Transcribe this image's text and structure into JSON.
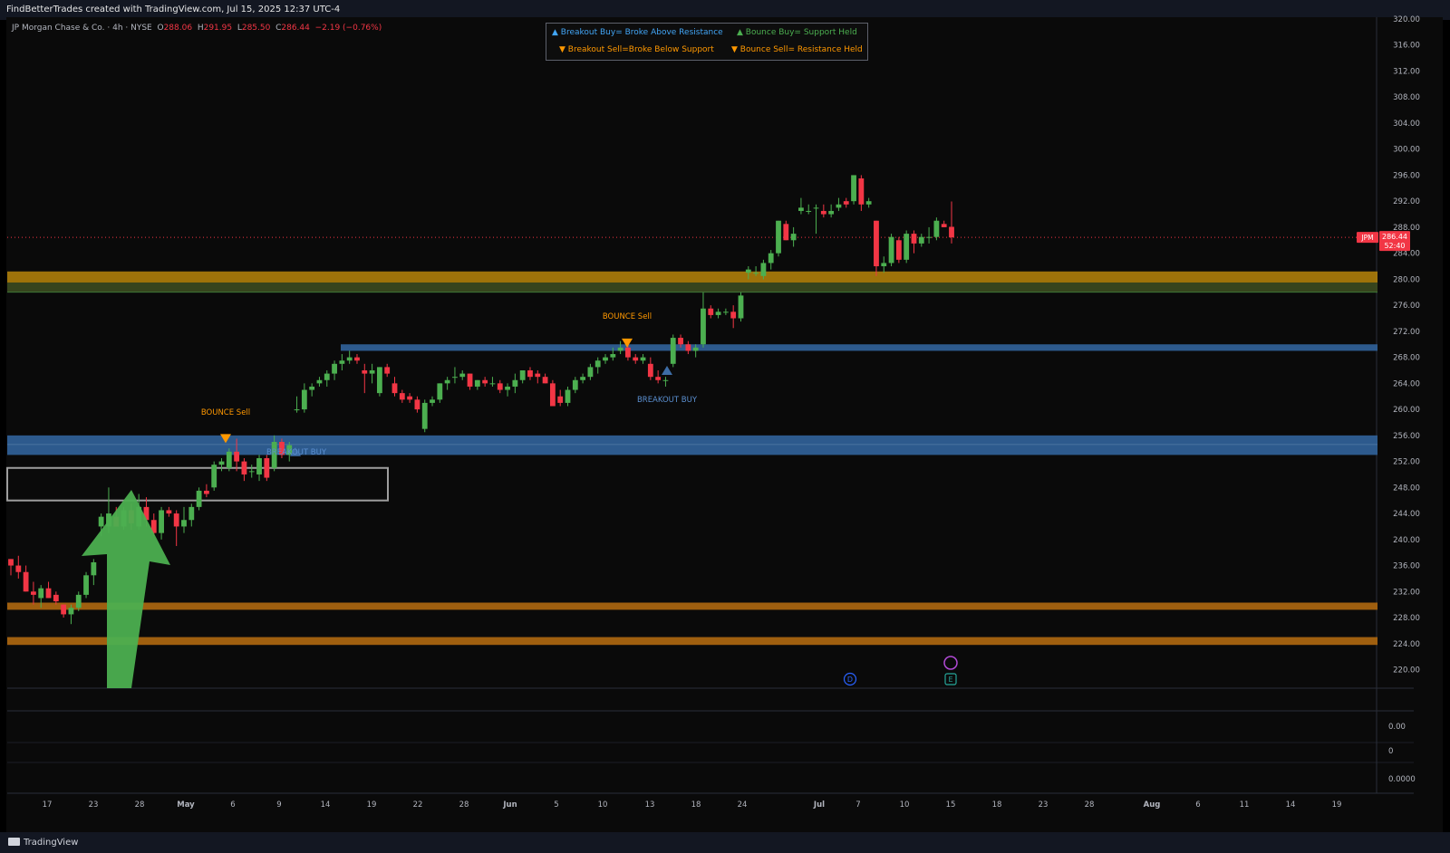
{
  "header": {
    "caption": "FindBetterTrades created with TradingView.com, Jul 15, 2025 12:37 UTC-4",
    "symbol_title": "JP Morgan Chase & Co. · 4h · NYSE",
    "ohlc": {
      "o_label": "O",
      "o_value": "288.06",
      "h_label": "H",
      "h_value": "291.95",
      "l_label": "L",
      "l_value": "285.50",
      "c_label": "C",
      "c_value": "286.44",
      "change": "−2.19 (−0.76%)"
    }
  },
  "legend": {
    "breakout_buy": "▲ Breakout Buy= Broke Above Resistance",
    "bounce_buy": "▲ Bounce Buy= Support Held",
    "breakout_sell": "▼ Breakout Sell=Broke Below Support",
    "bounce_sell": "▼ Bounce Sell= Resistance Held"
  },
  "price_tag": {
    "ticker": "JPM",
    "price": "286.44",
    "countdown": "52:40"
  },
  "footer": {
    "brand": "TradingView"
  },
  "colors": {
    "up": "#4caf50",
    "down": "#f23645",
    "support_blue": "#2f5f95",
    "gold": "#b8860b",
    "orange_band": "#a86410",
    "arrow_green": "#4caf50",
    "signal_orange": "#ff9800",
    "signal_blue": "#3d6da6"
  },
  "chart_data": {
    "type": "candlestick",
    "y_axis": {
      "ticks": [
        "320.00",
        "316.00",
        "312.00",
        "308.00",
        "304.00",
        "300.00",
        "296.00",
        "292.00",
        "288.00",
        "284.00",
        "280.00",
        "276.00",
        "272.00",
        "268.00",
        "264.00",
        "260.00",
        "256.00",
        "252.00",
        "248.00",
        "244.00",
        "240.00",
        "236.00",
        "232.00",
        "228.00",
        "224.00",
        "220.00"
      ],
      "range": [
        217.5,
        320.5
      ],
      "position": "right"
    },
    "x_axis": {
      "labels": [
        "17",
        "23",
        "28",
        "May",
        "6",
        "9",
        "14",
        "19",
        "22",
        "28",
        "Jun",
        "5",
        "10",
        "13",
        "18",
        "24",
        "Jul",
        "7",
        "10",
        "15",
        "18",
        "23",
        "28",
        "Aug",
        "6",
        "11",
        "14",
        "19"
      ]
    },
    "indicator_axis": {
      "ticks": [
        "0.00",
        "0",
        "0.0000"
      ]
    },
    "current_price": 286.44,
    "candles": [
      [
        237,
        237,
        234.5,
        236
      ],
      [
        236,
        237.5,
        234,
        235
      ],
      [
        235,
        236,
        232,
        232
      ],
      [
        232,
        233.5,
        230,
        231.5
      ],
      [
        231,
        233,
        229.5,
        232.5
      ],
      [
        232.5,
        233.5,
        231,
        231
      ],
      [
        231.5,
        232,
        230,
        230.5
      ],
      [
        230,
        230,
        228,
        228.5
      ],
      [
        228.5,
        230,
        227,
        229.5
      ],
      [
        229.5,
        232,
        229,
        231.5
      ],
      [
        231.5,
        235,
        231,
        234.5
      ],
      [
        234.5,
        237,
        233,
        236.5
      ],
      [
        242,
        244,
        240.5,
        243.5
      ],
      [
        242,
        248,
        241,
        244
      ],
      [
        243.5,
        245,
        242,
        242
      ],
      [
        242,
        245,
        241.5,
        244.5
      ],
      [
        244.5,
        245.5,
        241.5,
        242.5
      ],
      [
        242,
        247,
        241.5,
        245
      ],
      [
        245,
        246.5,
        242,
        243
      ],
      [
        243,
        244,
        240.5,
        241
      ],
      [
        241,
        245,
        240,
        244.5
      ],
      [
        244.5,
        245,
        243.5,
        244
      ],
      [
        244,
        244.5,
        239,
        242
      ],
      [
        242,
        245,
        241,
        243
      ],
      [
        243,
        245.5,
        242,
        245
      ],
      [
        245,
        248,
        244.5,
        247.5
      ],
      [
        247.5,
        248.5,
        246.5,
        247
      ],
      [
        248,
        252,
        247.5,
        251.5
      ],
      [
        251.5,
        252.5,
        250.5,
        252
      ],
      [
        251,
        254,
        250.5,
        253.5
      ],
      [
        253.5,
        255.5,
        250.5,
        252
      ],
      [
        252,
        252.5,
        249,
        250
      ],
      [
        250.5,
        251.5,
        249.5,
        250.5
      ],
      [
        250,
        253,
        249,
        252.5
      ],
      [
        252.5,
        253,
        249,
        249.5
      ],
      [
        251,
        256,
        250.5,
        255
      ],
      [
        255,
        255.5,
        252.5,
        253
      ],
      [
        253,
        255,
        252,
        254.5
      ],
      [
        260,
        262,
        259.5,
        260
      ],
      [
        260,
        264,
        259.5,
        263
      ],
      [
        263,
        264,
        262,
        263.5
      ],
      [
        264,
        265,
        263.5,
        264.5
      ],
      [
        264.5,
        266,
        263.5,
        265.5
      ],
      [
        265.5,
        267.5,
        264.5,
        267
      ],
      [
        267,
        268.5,
        266,
        267.5
      ],
      [
        267.5,
        269,
        267,
        268
      ],
      [
        268,
        268.5,
        267,
        267.5
      ],
      [
        266,
        267,
        262.5,
        265.5
      ],
      [
        265.5,
        267,
        264,
        266
      ],
      [
        262.5,
        266.5,
        262,
        266.5
      ],
      [
        266.5,
        267,
        265,
        265.5
      ],
      [
        264,
        265,
        262,
        262.5
      ],
      [
        262.5,
        263,
        261,
        261.5
      ],
      [
        262,
        262.5,
        261,
        261.5
      ],
      [
        261.5,
        262,
        259.5,
        260
      ],
      [
        257,
        261.5,
        256.5,
        261
      ],
      [
        261,
        262,
        260.5,
        261.5
      ],
      [
        261.5,
        264,
        261,
        264
      ],
      [
        264,
        265,
        263,
        264.5
      ],
      [
        265,
        266.5,
        264,
        265
      ],
      [
        265,
        266,
        264.5,
        265.5
      ],
      [
        265.5,
        265.5,
        263,
        263.5
      ],
      [
        263.5,
        264.5,
        263,
        264.5
      ],
      [
        264.5,
        265,
        263.5,
        264
      ],
      [
        264,
        265,
        263.5,
        264
      ],
      [
        264,
        264.5,
        262.5,
        263
      ],
      [
        263,
        264,
        262,
        263.5
      ],
      [
        263.5,
        265.5,
        262.5,
        264.5
      ],
      [
        264.5,
        266,
        264,
        266
      ],
      [
        266,
        266.5,
        264.5,
        265
      ],
      [
        265.5,
        266,
        264,
        265
      ],
      [
        265,
        265.5,
        264,
        264
      ],
      [
        264,
        264.5,
        260.5,
        260.5
      ],
      [
        262,
        263,
        260.5,
        261
      ],
      [
        261,
        263.5,
        260.5,
        263
      ],
      [
        263,
        265,
        262.5,
        264.5
      ],
      [
        264.5,
        265.5,
        264,
        265
      ],
      [
        265,
        267,
        264.5,
        266.5
      ],
      [
        266.5,
        268,
        265.5,
        267.5
      ],
      [
        267.5,
        268.5,
        267,
        268
      ],
      [
        268,
        269.5,
        267.5,
        268.5
      ],
      [
        269,
        270.5,
        268.5,
        269.5
      ],
      [
        269.5,
        270,
        267.5,
        268
      ],
      [
        268,
        268.5,
        267,
        267.5
      ],
      [
        267.5,
        268.5,
        267,
        268
      ],
      [
        267,
        268,
        264.5,
        265
      ],
      [
        265,
        266,
        264,
        264.5
      ],
      [
        264.5,
        265,
        263.5,
        264.5
      ],
      [
        267,
        271.5,
        266.5,
        271
      ],
      [
        271,
        271.5,
        269.5,
        270
      ],
      [
        270,
        270.5,
        268.5,
        269
      ],
      [
        269,
        270,
        268,
        269.5
      ],
      [
        270,
        278,
        269.5,
        275.5
      ],
      [
        275.5,
        276,
        274,
        274.5
      ],
      [
        274.5,
        275.5,
        274,
        275
      ],
      [
        275,
        275.5,
        274.5,
        275
      ],
      [
        275,
        276,
        272.5,
        274
      ],
      [
        274,
        278,
        273.5,
        277.5
      ],
      [
        281,
        282,
        280,
        281.5
      ],
      [
        281,
        282,
        280.5,
        281
      ],
      [
        280.5,
        283,
        280,
        282.5
      ],
      [
        282.5,
        284.5,
        281.5,
        284
      ],
      [
        284,
        289,
        283.5,
        289
      ],
      [
        288.5,
        289,
        286,
        286
      ],
      [
        286,
        288,
        285,
        287
      ],
      [
        290.5,
        292.5,
        290,
        291
      ],
      [
        290.5,
        291.5,
        290,
        290.5
      ],
      [
        291,
        291.5,
        287,
        291
      ],
      [
        290.5,
        291.5,
        289.5,
        290
      ],
      [
        290,
        291.5,
        289.5,
        290.5
      ],
      [
        291,
        292.5,
        290.5,
        291.5
      ],
      [
        292,
        292.5,
        291,
        291.5
      ],
      [
        292,
        296,
        291.5,
        296
      ],
      [
        295.5,
        296,
        290.5,
        291.5
      ],
      [
        291.5,
        292.5,
        291,
        292
      ],
      [
        289,
        289,
        280.5,
        282
      ],
      [
        282,
        283.5,
        281,
        282.5
      ],
      [
        282.5,
        287,
        282,
        286.5
      ],
      [
        286,
        286.5,
        282.5,
        283
      ],
      [
        283,
        287.5,
        282.5,
        287
      ],
      [
        287,
        287.5,
        284,
        285.5
      ],
      [
        285.5,
        287,
        285,
        286.5
      ],
      [
        286.5,
        288,
        285.5,
        286.5
      ],
      [
        286.5,
        289.5,
        286,
        289
      ],
      [
        288.5,
        289,
        288,
        288
      ],
      [
        288.06,
        291.95,
        285.5,
        286.44
      ]
    ],
    "zones": [
      {
        "label": "resistance-gold",
        "low": 279.5,
        "high": 281.2
      },
      {
        "label": "support-green",
        "low": 278.0,
        "high": 279.5
      },
      {
        "label": "resistance-blue-mid",
        "low": 269.0,
        "high": 270.0
      },
      {
        "label": "support-blue-low",
        "low": 253.0,
        "high": 256.0
      },
      {
        "label": "orange-band-1",
        "low": 229.2,
        "high": 230.3
      },
      {
        "label": "orange-band-2",
        "low": 223.8,
        "high": 225.0
      }
    ],
    "signals": [
      {
        "text": "BOUNCE Sell",
        "type": "sell",
        "price": 255.5
      },
      {
        "text": "BREAKOUT BUY",
        "type": "buy",
        "price": 253.5
      },
      {
        "text": "BOUNCE Sell",
        "type": "sell",
        "price": 270.2
      },
      {
        "text": "BREAKOUT BUY",
        "type": "buy",
        "price": 266.0
      }
    ],
    "events": [
      {
        "label": "D",
        "kind": "dividend"
      },
      {
        "label": "E",
        "kind": "earnings"
      }
    ]
  }
}
